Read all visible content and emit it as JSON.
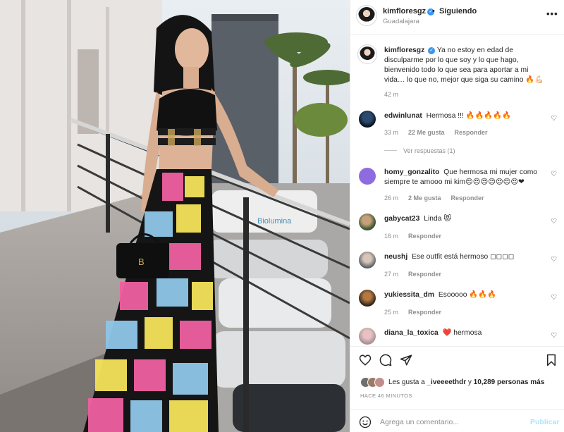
{
  "header": {
    "username": "kimfloresgz",
    "verified_mark": "✓",
    "separator": "•",
    "follow_state": "Siguiendo",
    "location": "Guadalajara",
    "more_label": "•••"
  },
  "caption": {
    "username": "kimfloresgz",
    "text": "Ya no estoy en edad de disculparme por lo que soy y lo que hago, bienvenido todo lo que sea para aportar a mi vida… lo que no, mejor que siga su camino 🔥💪🏻",
    "time": "42 m"
  },
  "comments": [
    {
      "username": "edwinlunat",
      "text": "Hermosa !!! 🔥🔥🔥🔥🔥",
      "time": "33 m",
      "likes": "22 Me gusta",
      "reply": "Responder",
      "view_replies": "Ver respuestas (1)"
    },
    {
      "username": "homy_gonzalito",
      "text": "Que hermosa mi mujer como siempre te amooo mi kim😍😍😍😍😍😍😍❤",
      "time": "26 m",
      "likes": "2 Me gusta",
      "reply": "Responder"
    },
    {
      "username": "gabycat23",
      "text": "Linda 😻",
      "time": "16 m",
      "reply": "Responder"
    },
    {
      "username": "neushj",
      "text": "Ese outfit está hermoso ◻◻◻◻",
      "time": "27 m",
      "reply": "Responder"
    },
    {
      "username": "yukiessita_dm",
      "text": "Esooooo 🔥🔥🔥",
      "time": "25 m",
      "reply": "Responder"
    },
    {
      "username": "diana_la_toxica",
      "text": "❤️ hermosa"
    }
  ],
  "icons": {
    "heart": "heart-icon",
    "comment": "comment-bubble-icon",
    "share": "paper-plane-icon",
    "save": "bookmark-icon",
    "emoji": "emoji-icon",
    "more": "more-options-icon"
  },
  "likes": {
    "prefix": "Les gusta a",
    "first_user": "_iveeeethdr",
    "conjunction": "y",
    "others": "10,289 personas más"
  },
  "timestamp": "HACE 46 MINUTOS",
  "add_comment": {
    "placeholder": "Agrega un comentario...",
    "publish": "Publicar"
  },
  "photo": {
    "sign_text": "Biolumina"
  },
  "colors": {
    "accent_blue": "#3897f0",
    "publish_disabled": "#b2dffc",
    "muted_text": "#8e8e8e",
    "border": "#efefef"
  }
}
